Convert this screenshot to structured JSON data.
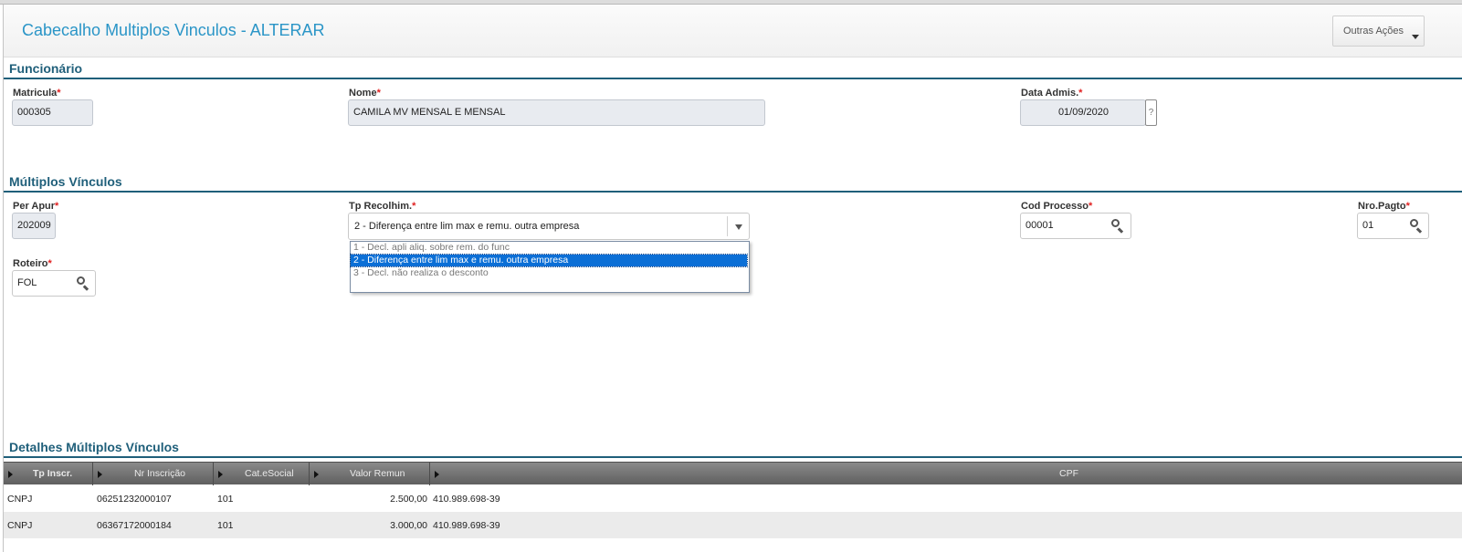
{
  "header": {
    "title": "Cabecalho Multiplos Vinculos - ALTERAR",
    "actions_label": "Outras Ações"
  },
  "funcionario": {
    "section_title": "Funcionário",
    "matricula": {
      "label": "Matricula",
      "value": "000305"
    },
    "nome": {
      "label": "Nome",
      "value": "CAMILA MV MENSAL E MENSAL"
    },
    "data_admis": {
      "label": "Data Admis.",
      "value": "01/09/2020",
      "help": "?"
    }
  },
  "multiplos": {
    "section_title": "Múltiplos Vínculos",
    "per_apur": {
      "label": "Per Apur",
      "value": "202009"
    },
    "tp_recolhim": {
      "label": "Tp Recolhim.",
      "value": "2 - Diferença entre lim max e remu. outra empresa",
      "options": [
        "1 - Decl. apli aliq. sobre rem. do func",
        "2 - Diferença entre lim max e remu. outra empresa",
        "3 - Decl. não realiza o desconto"
      ],
      "selected_index": 1
    },
    "cod_processo": {
      "label": "Cod Processo",
      "value": "00001"
    },
    "nro_pagto": {
      "label": "Nro.Pagto",
      "value": "01"
    },
    "roteiro": {
      "label": "Roteiro",
      "value": "FOL"
    }
  },
  "detalhes": {
    "section_title": "Detalhes Múltiplos Vínculos",
    "columns": [
      "Tp Inscr.",
      "Nr Inscrição",
      "Cat.eSocial",
      "Valor Remun",
      "CPF"
    ],
    "rows": [
      {
        "tp_inscr": "CNPJ",
        "nr_inscricao": "06251232000107",
        "cat_esocial": "101",
        "valor_remun": "2.500,00",
        "cpf": "410.989.698-39"
      },
      {
        "tp_inscr": "CNPJ",
        "nr_inscricao": "06367172000184",
        "cat_esocial": "101",
        "valor_remun": "3.000,00",
        "cpf": "410.989.698-39"
      }
    ]
  },
  "required_mark": "*",
  "colors": {
    "title_blue": "#2a95c7",
    "section_dark": "#1f5f7a",
    "required_red": "#e02020",
    "selection_blue": "#0b6fd6"
  },
  "icons": {
    "lookup": "search-icon",
    "dropdown": "chevron-down-icon",
    "column_sort": "triangle-right-icon"
  }
}
